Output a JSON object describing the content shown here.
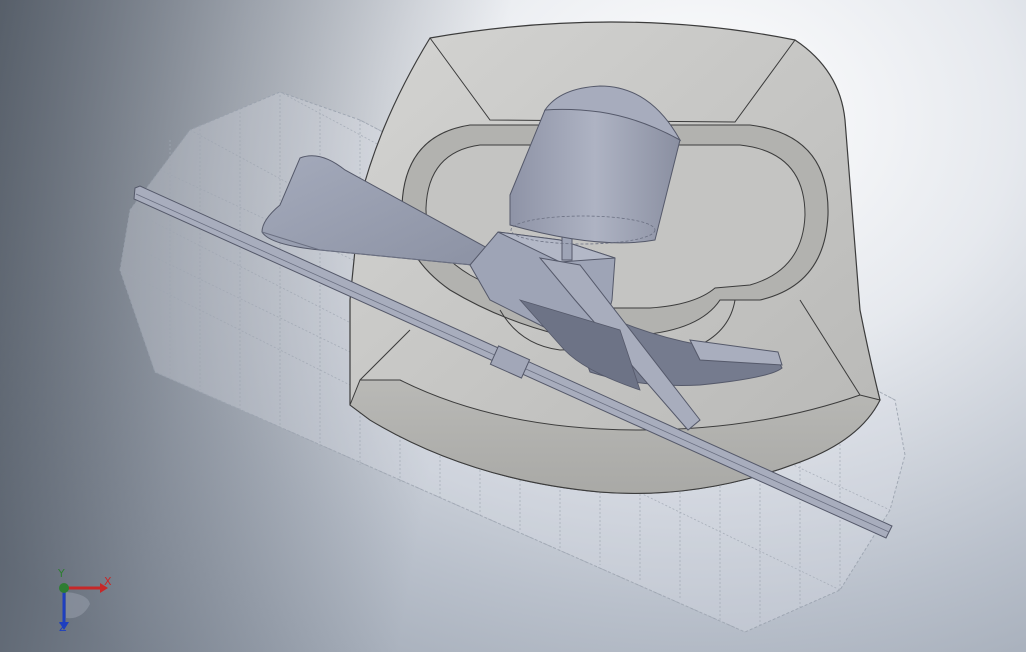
{
  "viewport": {
    "background_top": "#ffffff",
    "background_bottom": "#98a1ae",
    "part_face_color": "#c6c6c4",
    "part_edge_color": "#3c3c3c",
    "component_color": "#9da3b4",
    "hidden_body_color": "#d9dde6"
  },
  "triad": {
    "x_label": "X",
    "y_label": "Y",
    "z_label": "Z",
    "x_color": "#c62828",
    "y_color": "#2e7d32",
    "z_color": "#1e3fbf"
  }
}
